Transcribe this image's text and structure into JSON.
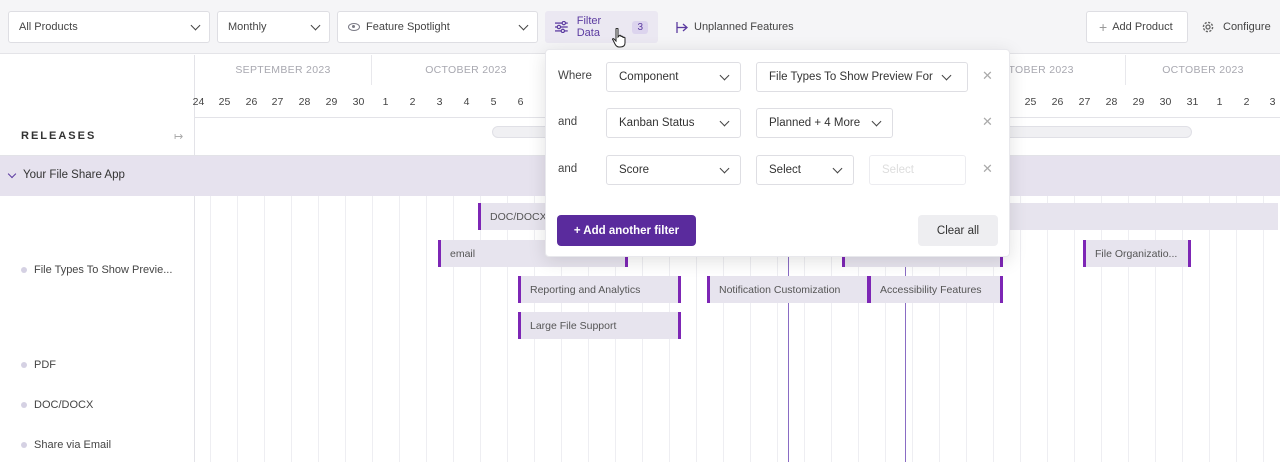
{
  "toolbar": {
    "product_select": "All Products",
    "period_select": "Monthly",
    "view_select": "Feature Spotlight",
    "filter_label": "Filter Data",
    "filter_count": "3",
    "unplanned_label": "Unplanned Features",
    "add_product_label": "Add Product",
    "configure_label": "Configure"
  },
  "timeline": {
    "months": [
      "SEPTEMBER 2023",
      "OCTOBER 2023",
      "OCTOBER 2023",
      "OCTOBER 2023"
    ],
    "days_left": [
      "24",
      "25",
      "26",
      "27",
      "28",
      "29",
      "30",
      "1",
      "2",
      "3",
      "4",
      "5",
      "6"
    ],
    "days_right": [
      "25",
      "26",
      "27",
      "28",
      "29",
      "30",
      "31",
      "1",
      "2",
      "3"
    ]
  },
  "releases": {
    "label": "RELEASES",
    "app_name": "Your File Share App",
    "features": [
      "File Types To Show Previe...",
      "PDF",
      "DOC/DOCX",
      "Share via Email"
    ]
  },
  "bars": {
    "doc": "DOC/DOCX",
    "email": "email",
    "reporting": "Reporting and Analytics",
    "notification": "Notification Customization",
    "accessibility": "Accessibility Features",
    "large_file": "Large File Support",
    "file_org": "File Organizatio..."
  },
  "filter_popup": {
    "rows": [
      {
        "conj": "Where",
        "field": "Component",
        "value": "File Types To Show Preview For"
      },
      {
        "conj": "and",
        "field": "Kanban Status",
        "value": "Planned + 4 More"
      },
      {
        "conj": "and",
        "field": "Score",
        "value": "Select",
        "extra": "Select"
      }
    ],
    "add_label": "+ Add another filter",
    "clear_label": "Clear all"
  },
  "colors": {
    "accent": "#5a2b9d",
    "bar_border": "#7d26b5",
    "row_highlight": "#e6e2ee"
  }
}
